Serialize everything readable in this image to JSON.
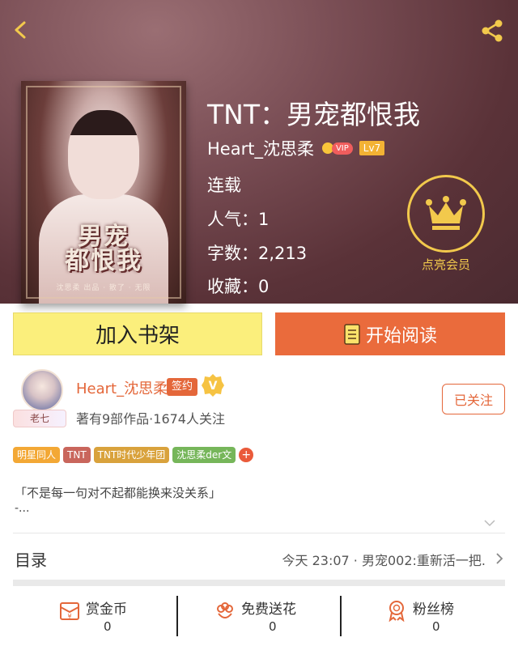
{
  "header": {
    "book_title": "TNT：男宠都恨我",
    "author": "Heart_沈思柔",
    "vip_label": "VIP",
    "level": "Lv7",
    "status": "连载",
    "popularity": "人气：1",
    "word_count": "字数：2,213",
    "favorites": "收藏：0",
    "member_label": "点亮会员"
  },
  "cover": {
    "title_line1": "男宠",
    "title_line2": "都恨我",
    "subtitle": "沈思柔 出品 · 散了 · 无限"
  },
  "actions": {
    "add_to_shelf": "加入书架",
    "start_reading": "开始阅读"
  },
  "author_card": {
    "name": "Heart_沈思柔",
    "signed": "签约",
    "avatar_tag": "老七",
    "summary": "著有9部作品·1674人关注",
    "follow": "已关注"
  },
  "tags": [
    {
      "label": "明星同人",
      "color": "#f3a835"
    },
    {
      "label": "TNT",
      "color": "#c9665c"
    },
    {
      "label": "TNT时代少年团",
      "color": "#d9a23c"
    },
    {
      "label": "沈思柔der文",
      "color": "#76b65a"
    }
  ],
  "description": {
    "line1": "「不是每一句对不起都能换来没关系」",
    "line2": "-..."
  },
  "toc": {
    "label": "目录",
    "latest": "今天 23:07 · 男宠002:重新活一把."
  },
  "stats": [
    {
      "label": "赏金币",
      "value": "0"
    },
    {
      "label": "免费送花",
      "value": "0"
    },
    {
      "label": "粉丝榜",
      "value": "0"
    }
  ],
  "colors": {
    "accent": "#e4673a",
    "shelf_button": "#fbef7c",
    "read_button": "#ea6b3c",
    "member_gold": "#f2c94c"
  }
}
